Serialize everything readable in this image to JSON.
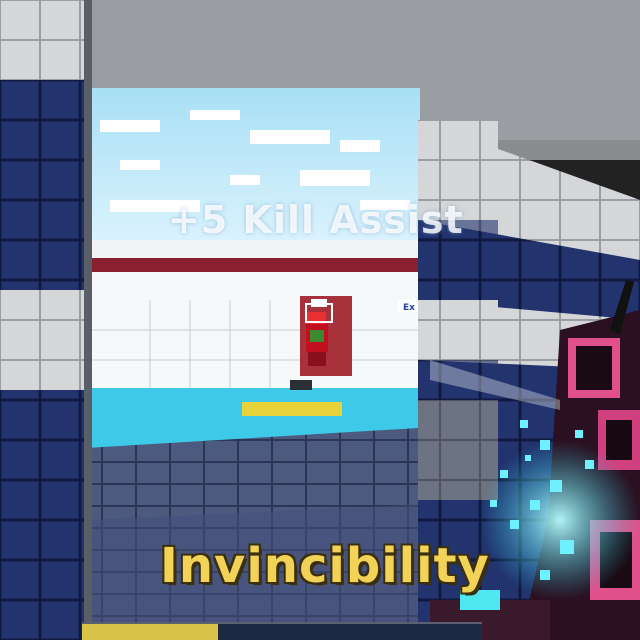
{
  "hud": {
    "kill_message": "+5 Kill Assist",
    "powerup_name": "Invincibility",
    "powerup_progress": 0.34,
    "accent_color": "#f2d257",
    "bar_fill_color": "#d9c24a"
  },
  "scene": {
    "sign_text": "Ex"
  }
}
